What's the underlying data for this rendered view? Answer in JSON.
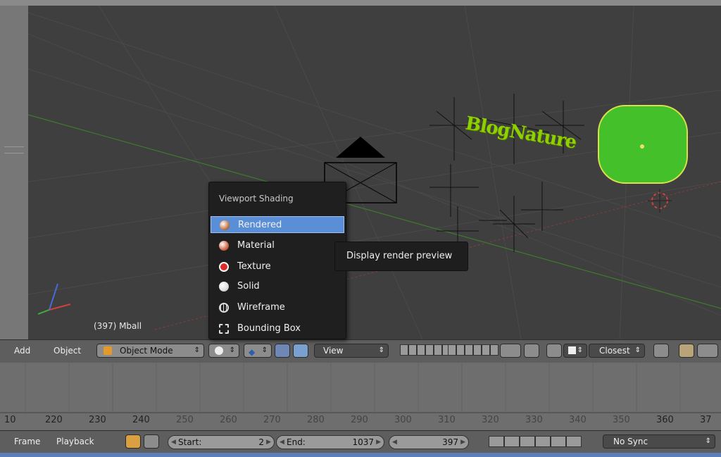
{
  "viewport": {
    "info_text": "(397) Mball",
    "blog_text": "BlogNature"
  },
  "shading_menu": {
    "title": "Viewport Shading",
    "items": [
      {
        "label": "Rendered",
        "icon": "rendered-sphere-icon",
        "selected": true
      },
      {
        "label": "Material",
        "icon": "material-sphere-icon",
        "selected": false
      },
      {
        "label": "Texture",
        "icon": "texture-sphere-icon",
        "selected": false
      },
      {
        "label": "Solid",
        "icon": "solid-sphere-icon",
        "selected": false
      },
      {
        "label": "Wireframe",
        "icon": "wireframe-sphere-icon",
        "selected": false
      },
      {
        "label": "Bounding Box",
        "icon": "bounding-box-icon",
        "selected": false
      }
    ],
    "tooltip": "Display render preview"
  },
  "header": {
    "add": "Add",
    "object": "Object",
    "mode": "Object Mode",
    "view": "View",
    "pivot": "Closest"
  },
  "timeline": {
    "numbers": [
      "10",
      "220",
      "230",
      "240",
      "250",
      "260",
      "270",
      "280",
      "290",
      "300",
      "310",
      "320",
      "330",
      "340",
      "350",
      "360",
      "37"
    ]
  },
  "footer": {
    "frame": "Frame",
    "playback": "Playback",
    "start_label": "Start:",
    "start_value": "2",
    "end_label": "End:",
    "end_value": "1037",
    "current_frame": "397",
    "sync": "No Sync"
  },
  "colors": {
    "selected": "#5a8ed6",
    "green_object": "#44c02a",
    "text_green": "#8fd000"
  }
}
